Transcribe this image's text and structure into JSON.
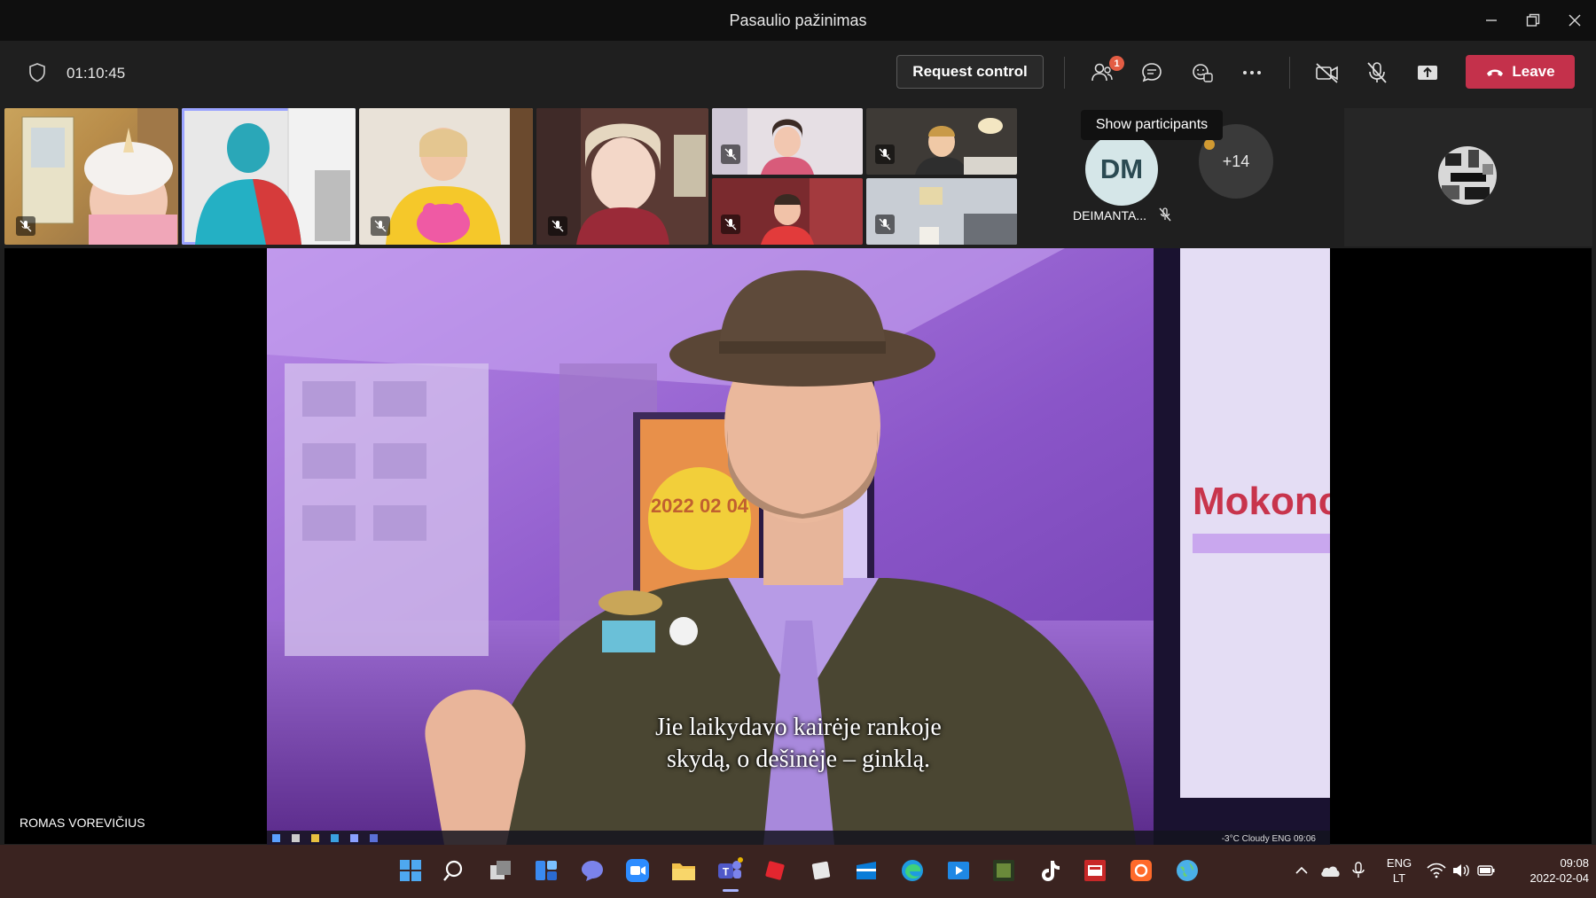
{
  "window": {
    "title": "Pasaulio pažinimas"
  },
  "toolbar": {
    "timer": "01:10:45",
    "request_control_label": "Request control",
    "participants_badge": "1",
    "leave_label": "Leave",
    "tooltip": "Show participants"
  },
  "participants": {
    "dm_initials": "DM",
    "dm_name": "DEIMANTA...",
    "overflow_count": "+14"
  },
  "stage": {
    "subtitle_line1": "Jie laikydavo kairėje rankoje",
    "subtitle_line2": "skydą, o dešinėje – ginklą.",
    "video_sign_text": "Mokonc",
    "video_date_text": "2022 02 04",
    "speaker_name": "ROMAS VOREVIČIUS",
    "inner_tray": "-3°C Cloudy  ENG 09:06"
  },
  "taskbar": {
    "language_line1": "ENG",
    "language_line2": "LT",
    "time": "09:08",
    "date": "2022-02-04"
  },
  "colors": {
    "leave": "#c4314b",
    "selected_tile": "#9aa3ff",
    "taskbar": "#3a2320"
  }
}
